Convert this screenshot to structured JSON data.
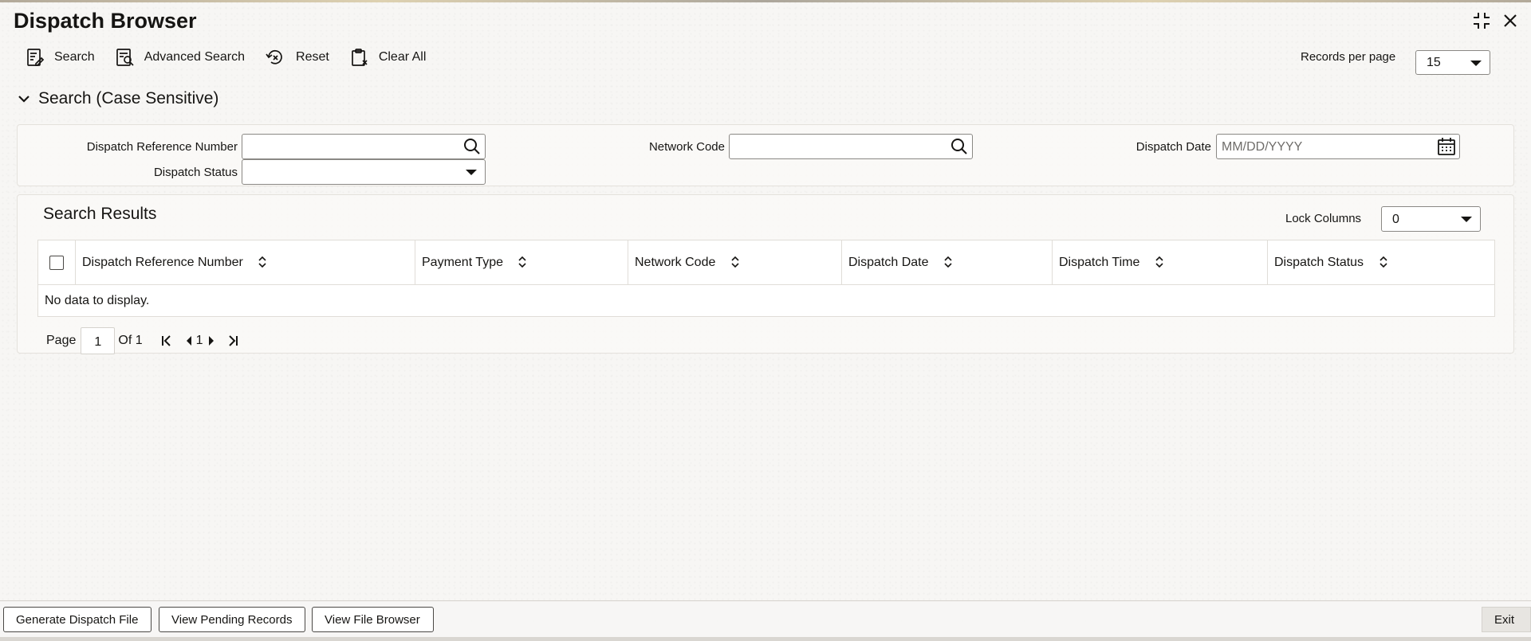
{
  "window": {
    "title": "Dispatch Browser"
  },
  "toolbar": {
    "search": "Search",
    "advanced_search": "Advanced Search",
    "reset": "Reset",
    "clear_all": "Clear All"
  },
  "records_per_page": {
    "label": "Records per page",
    "value": "15"
  },
  "search_section": {
    "title": "Search (Case Sensitive)",
    "fields": {
      "dispatch_reference_number": {
        "label": "Dispatch Reference Number",
        "value": ""
      },
      "network_code": {
        "label": "Network Code",
        "value": ""
      },
      "dispatch_date": {
        "label": "Dispatch Date",
        "placeholder": "MM/DD/YYYY"
      },
      "dispatch_status": {
        "label": "Dispatch Status",
        "value": ""
      }
    }
  },
  "results": {
    "title": "Search Results",
    "lock_columns": {
      "label": "Lock Columns",
      "value": "0"
    },
    "columns": [
      "Dispatch Reference Number",
      "Payment Type",
      "Network Code",
      "Dispatch Date",
      "Dispatch Time",
      "Dispatch Status"
    ],
    "empty_message": "No data to display.",
    "pagination": {
      "page_label": "Page",
      "current_page": "1",
      "of_label": "Of 1",
      "nav_page": "1"
    }
  },
  "footer": {
    "generate_dispatch_file": "Generate Dispatch File",
    "view_pending_records": "View Pending Records",
    "view_file_browser": "View File Browser",
    "exit": "Exit"
  }
}
